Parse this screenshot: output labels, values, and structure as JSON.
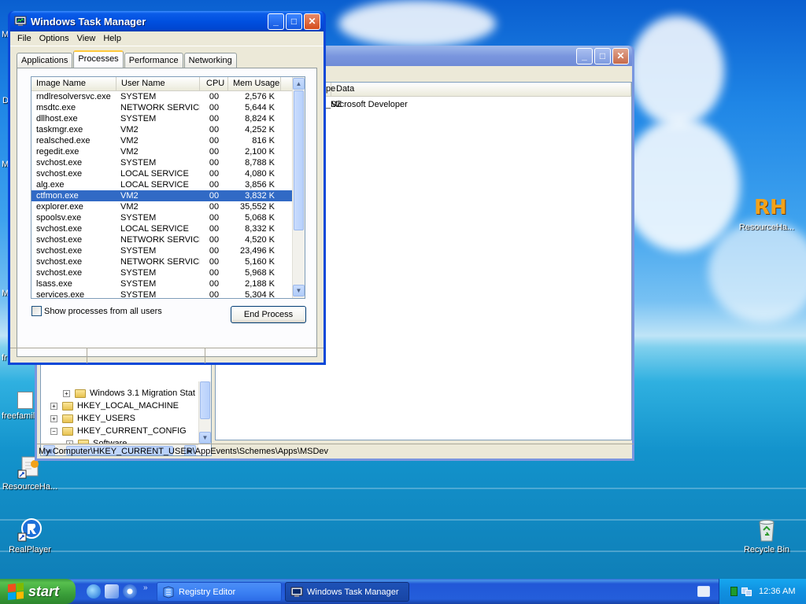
{
  "desktop": {
    "icons": [
      {
        "label": "ResourceHa...",
        "name": "resourcehacker-desktop-icon-right"
      },
      {
        "label": "ResourceHa...",
        "name": "resourcehacker-desktop-icon-left"
      },
      {
        "label": "RealPlayer",
        "name": "realplayer-desktop-icon"
      },
      {
        "label": "Recycle Bin",
        "name": "recycle-bin-desktop-icon"
      },
      {
        "label": "freefamil",
        "name": "freefamily-desktop-icon"
      }
    ],
    "left_fragments": [
      "M",
      "D",
      "M",
      "M",
      "fr"
    ],
    "rh_logo_text": "RH"
  },
  "regedit": {
    "title": "",
    "list_columns": [
      "pe",
      "Data"
    ],
    "list_rows": [
      {
        "type": "_SZ",
        "data": "Microsoft Developer"
      }
    ],
    "tree": [
      {
        "label": "Windows 3.1 Migration Stat",
        "indent": 2
      },
      {
        "label": "HKEY_LOCAL_MACHINE",
        "indent": 0
      },
      {
        "label": "HKEY_USERS",
        "indent": 0
      },
      {
        "label": "HKEY_CURRENT_CONFIG",
        "indent": 0
      },
      {
        "label": "Software",
        "indent": 1
      }
    ],
    "status_path": "My Computer\\HKEY_CURRENT_USER\\AppEvents\\Schemes\\Apps\\MSDev"
  },
  "taskmgr": {
    "title": "Windows Task Manager",
    "menu": [
      "File",
      "Options",
      "View",
      "Help"
    ],
    "tabs": [
      "Applications",
      "Processes",
      "Performance",
      "Networking"
    ],
    "active_tab": "Processes",
    "columns": [
      "Image Name",
      "User Name",
      "CPU",
      "Mem Usage"
    ],
    "processes": [
      {
        "name": "rndlresolversvc.exe",
        "user": "SYSTEM",
        "cpu": "00",
        "mem": "2,576 K"
      },
      {
        "name": "msdtc.exe",
        "user": "NETWORK SERVICE",
        "cpu": "00",
        "mem": "5,644 K"
      },
      {
        "name": "dllhost.exe",
        "user": "SYSTEM",
        "cpu": "00",
        "mem": "8,824 K"
      },
      {
        "name": "taskmgr.exe",
        "user": "VM2",
        "cpu": "00",
        "mem": "4,252 K"
      },
      {
        "name": "realsched.exe",
        "user": "VM2",
        "cpu": "00",
        "mem": "816 K"
      },
      {
        "name": "regedit.exe",
        "user": "VM2",
        "cpu": "00",
        "mem": "2,100 K"
      },
      {
        "name": "svchost.exe",
        "user": "SYSTEM",
        "cpu": "00",
        "mem": "8,788 K"
      },
      {
        "name": "svchost.exe",
        "user": "LOCAL SERVICE",
        "cpu": "00",
        "mem": "4,080 K"
      },
      {
        "name": "alg.exe",
        "user": "LOCAL SERVICE",
        "cpu": "00",
        "mem": "3,856 K"
      },
      {
        "name": "ctfmon.exe",
        "user": "VM2",
        "cpu": "00",
        "mem": "3,832 K"
      },
      {
        "name": "explorer.exe",
        "user": "VM2",
        "cpu": "00",
        "mem": "35,552 K"
      },
      {
        "name": "spoolsv.exe",
        "user": "SYSTEM",
        "cpu": "00",
        "mem": "5,068 K"
      },
      {
        "name": "svchost.exe",
        "user": "LOCAL SERVICE",
        "cpu": "00",
        "mem": "8,332 K"
      },
      {
        "name": "svchost.exe",
        "user": "NETWORK SERVICE",
        "cpu": "00",
        "mem": "4,520 K"
      },
      {
        "name": "svchost.exe",
        "user": "SYSTEM",
        "cpu": "00",
        "mem": "23,496 K"
      },
      {
        "name": "svchost.exe",
        "user": "NETWORK SERVICE",
        "cpu": "00",
        "mem": "5,160 K"
      },
      {
        "name": "svchost.exe",
        "user": "SYSTEM",
        "cpu": "00",
        "mem": "5,968 K"
      },
      {
        "name": "lsass.exe",
        "user": "SYSTEM",
        "cpu": "00",
        "mem": "2,188 K"
      },
      {
        "name": "services.exe",
        "user": "SYSTEM",
        "cpu": "00",
        "mem": "5,304 K"
      }
    ],
    "selected_index": 9,
    "show_all_label": "Show processes from all users",
    "show_all_checked": false,
    "end_process_label": "End Process"
  },
  "taskbar": {
    "start_label": "start",
    "tasks": [
      {
        "label": "Registry Editor",
        "active": false
      },
      {
        "label": "Windows Task Manager",
        "active": true
      }
    ],
    "chevron": "»",
    "clock": "12:36 AM"
  },
  "colors": {
    "xp_blue": "#0a48d8",
    "selection": "#316ac5",
    "start_green": "#3a9f3a"
  }
}
